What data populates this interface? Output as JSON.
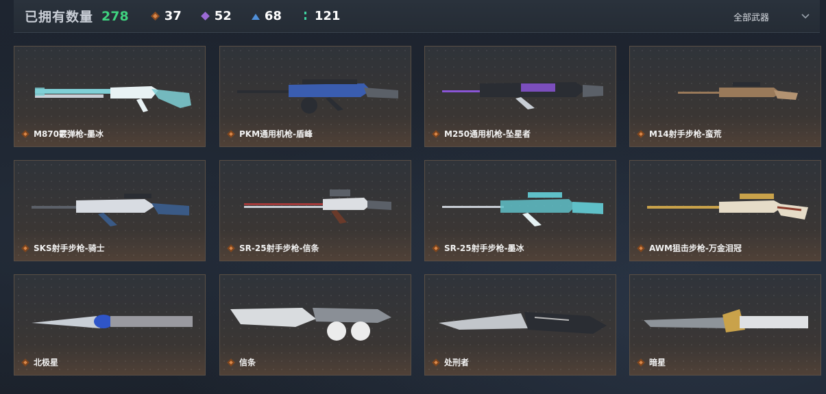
{
  "header": {
    "owned_label": "已拥有数量",
    "owned_count": "278",
    "rarity": [
      {
        "icon": "orange-diamond-icon",
        "color": "#d9884a",
        "value": "37"
      },
      {
        "icon": "purple-diamond-icon",
        "color": "#9b6ad6",
        "value": "52"
      },
      {
        "icon": "blue-triangle-icon",
        "color": "#4f8fd9",
        "value": "68"
      },
      {
        "icon": "green-dots-icon",
        "color": "#3fd3a0",
        "value": "121"
      }
    ],
    "filter_label": "全部武器",
    "filter_icon": "chevron-down-icon"
  },
  "items": [
    {
      "name": "M870霰弹枪-墨冰",
      "kind": "shotgun",
      "accent": "#7fd0d6"
    },
    {
      "name": "PKM通用机枪-盾峰",
      "kind": "mg",
      "accent": "#3a5db0"
    },
    {
      "name": "M250通用机枪-坠星者",
      "kind": "mg2",
      "accent": "#8a55d6"
    },
    {
      "name": "M14射手步枪-蛮荒",
      "kind": "sniper-small",
      "accent": "#9a7a5a"
    },
    {
      "name": "SKS射手步枪-骑士",
      "kind": "rifle",
      "accent": "#3a5a86"
    },
    {
      "name": "SR-25射手步枪-信条",
      "kind": "rifle2",
      "accent": "#a33a3a"
    },
    {
      "name": "SR-25射手步枪-墨冰",
      "kind": "rifle3",
      "accent": "#5fc0c8"
    },
    {
      "name": "AWM狙击步枪-万金泪冠",
      "kind": "awm",
      "accent": "#c9a24a"
    },
    {
      "name": "北极星",
      "kind": "knife1",
      "accent": "#2f55c8"
    },
    {
      "name": "信条",
      "kind": "knife2",
      "accent": "#a33a3a"
    },
    {
      "name": "处刑者",
      "kind": "knife3",
      "accent": "#7a7a7a"
    },
    {
      "name": "暗星",
      "kind": "knife4",
      "accent": "#c9a24a"
    }
  ]
}
